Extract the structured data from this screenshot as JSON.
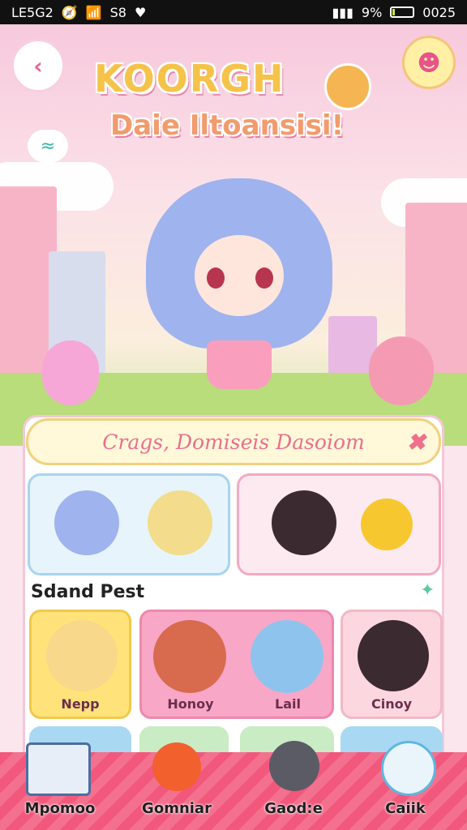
{
  "status_bar": {
    "carrier": "LE5G2",
    "signal_text": "S8",
    "battery_percent": "9%",
    "time": "0025"
  },
  "header": {
    "back_icon": "back-arrow-icon",
    "settings_icon": "pet-face-icon",
    "logo": "KOORGH",
    "subtitle": "Daie Iltoansisi!"
  },
  "banner": {
    "text": "Crags, Domiseis Dasoiom"
  },
  "section": {
    "title": "Sdand Pest"
  },
  "characters": [
    {
      "name": "Nepp",
      "color": "#ffe37a",
      "hair": "#f8d88a"
    },
    {
      "name": "Honoy",
      "color": "#f9a7c6",
      "hair": "#d86a4e"
    },
    {
      "name": "Lail",
      "color": "#f9a7c6",
      "hair": "#8ec3ee"
    },
    {
      "name": "Cinoy",
      "color": "#fdd7df",
      "hair": "#3b2a2f"
    }
  ],
  "nav": {
    "items": [
      {
        "label": "Mpomoo",
        "icon": "books-icon"
      },
      {
        "label": "Gomniar",
        "icon": "apple-icon"
      },
      {
        "label": "Gaod:e",
        "icon": "bear-icon"
      },
      {
        "label": "Caiik",
        "icon": "ghost-face-icon"
      }
    ]
  }
}
